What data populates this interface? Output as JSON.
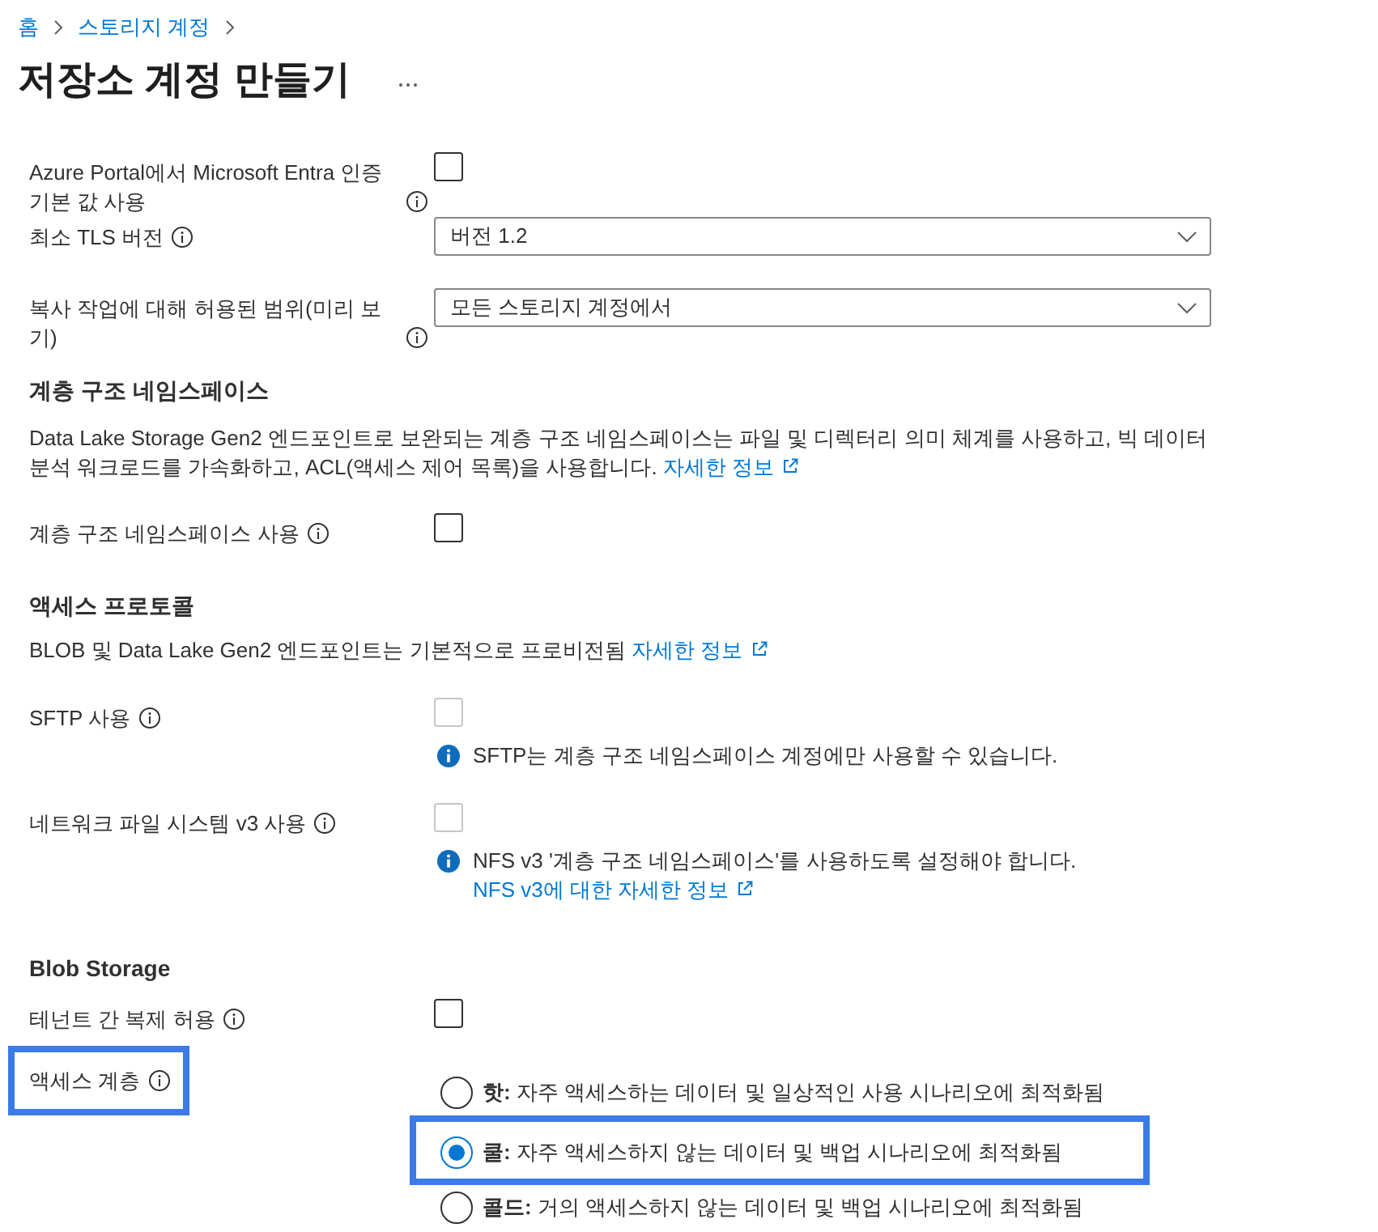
{
  "breadcrumb": [
    {
      "label": "홈"
    },
    {
      "label": "스토리지 계정"
    }
  ],
  "title": "저장소 계정 만들기",
  "settings": [
    {
      "kind": "checkbox",
      "label": "Azure Portal에서 Microsoft Entra 인증 기본 값 사용",
      "checked": false,
      "disabled": false,
      "highlighted": false
    },
    {
      "kind": "dropdown",
      "label": "최소 TLS 버전",
      "value": "버전 1.2",
      "highlighted": false
    },
    {
      "kind": "dropdown",
      "label": "복사 작업에 대해 허용된 범위(미리 보기)",
      "value": "모든 스토리지 계정에서",
      "highlighted": false
    }
  ],
  "sections": [
    {
      "heading": "계층 구조 네임스페이스",
      "description": {
        "text": "Data Lake Storage Gen2 엔드포인트로 보완되는 계층 구조 네임스페이스는 파일 및 디렉터리 의미 체계를 사용하고, 빅 데이터 분석 워크로드를 가속화하고, ACL(액세스 제어 목록)을 사용합니다.",
        "link": "자세한 정보"
      },
      "settings": [
        {
          "kind": "checkbox",
          "label": "계층 구조 네임스페이스 사용",
          "checked": false,
          "disabled": false,
          "highlighted": false
        }
      ]
    },
    {
      "heading": "액세스 프로토콜",
      "description": {
        "text": "BLOB 및 Data Lake Gen2 엔드포인트는 기본적으로 프로비전됨",
        "link": "자세한 정보"
      },
      "settings": [
        {
          "kind": "checkbox",
          "label": "SFTP 사용",
          "checked": false,
          "disabled": true,
          "highlighted": false,
          "note": {
            "text": "SFTP는 계층 구조 네임스페이스 계정에만 사용할 수 있습니다."
          }
        },
        {
          "kind": "checkbox",
          "label": "네트워크 파일 시스템 v3 사용",
          "checked": false,
          "disabled": true,
          "highlighted": false,
          "note": {
            "text": "NFS v3 '계층 구조 네임스페이스'를 사용하도록 설정해야 합니다.",
            "link": "NFS v3에 대한 자세한 정보"
          }
        }
      ]
    },
    {
      "heading": "Blob Storage",
      "settings": [
        {
          "kind": "checkbox",
          "label": "테넌트 간 복제 허용",
          "checked": false,
          "disabled": false,
          "highlighted": false
        },
        {
          "kind": "radio",
          "label": "액세스 계층",
          "highlighted": true,
          "options": [
            {
              "label": "**핫:** 자주 액세스하는 데이터 및 일상적인 사용 시나리오에 최적화됨",
              "selected": false,
              "highlighted": false
            },
            {
              "label": "**쿨:** 자주 액세스하지 않는 데이터 및 백업 시나리오에 최적화됨",
              "selected": true,
              "highlighted": true
            },
            {
              "label": "**콜드:** 거의 액세스하지 않는 데이터 및 백업 시나리오에 최적화됨",
              "selected": false,
              "highlighted": false
            }
          ]
        }
      ]
    }
  ]
}
